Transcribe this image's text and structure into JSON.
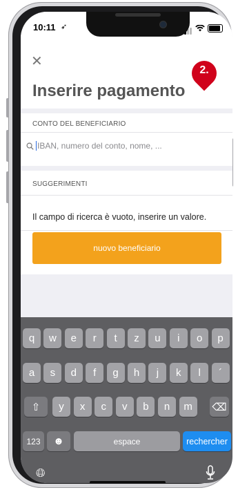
{
  "status_bar": {
    "time": "10:11"
  },
  "header": {
    "close_icon": "close-icon",
    "title": "Inserire pagamento",
    "badge": "2."
  },
  "beneficiary": {
    "section_title": "CONTO DEL BENEFICIARIO",
    "search_placeholder": "IBAN, numero del conto, nome, ...",
    "search_value": ""
  },
  "suggestions": {
    "section_title": "SUGGERIMENTI",
    "empty_message": "Il campo di ricerca è vuoto, inserire un valore.",
    "new_beneficiary_button": "nuovo beneficiario"
  },
  "keyboard": {
    "row1": [
      "q",
      "w",
      "e",
      "r",
      "t",
      "z",
      "u",
      "i",
      "o",
      "p"
    ],
    "row2": [
      "a",
      "s",
      "d",
      "f",
      "g",
      "h",
      "j",
      "k",
      "l",
      "´"
    ],
    "row3": [
      "y",
      "x",
      "c",
      "v",
      "b",
      "n",
      "m"
    ],
    "numbers_key": "123",
    "space_key": "espace",
    "return_key": "rechercher"
  },
  "colors": {
    "accent": "#f3a21c",
    "badge": "#d0021b",
    "keyboard_bg": "#5e5e61",
    "return_key": "#1e8df0"
  }
}
